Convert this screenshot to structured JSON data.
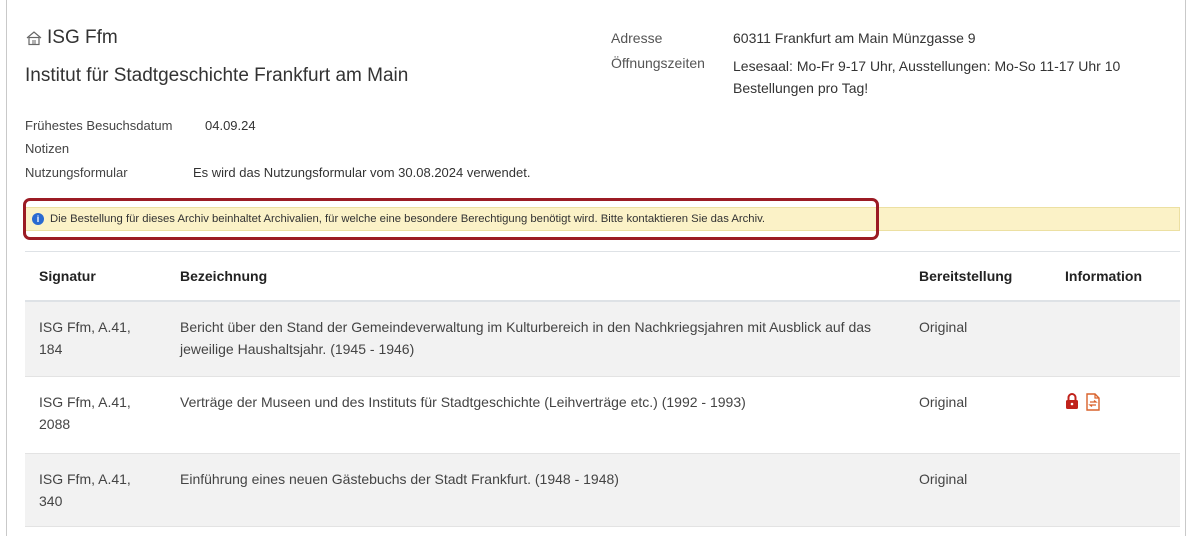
{
  "header": {
    "title": "ISG Ffm",
    "subtitle": "Institut für Stadtgeschichte Frankfurt am Main",
    "address_label": "Adresse",
    "address_value": "60311 Frankfurt am Main Münzgasse 9",
    "hours_label": "Öffnungszeiten",
    "hours_value": "Lesesaal: Mo-Fr 9-17 Uhr, Ausstellungen: Mo-So 11-17 Uhr 10 Bestellungen pro Tag!"
  },
  "meta": {
    "visit_label": "Frühestes Besuchsdatum",
    "visit_value": "04.09.24",
    "notes_label": "Notizen",
    "form_label": "Nutzungsformular",
    "form_value": "Es wird das Nutzungsformular vom 30.08.2024 verwendet."
  },
  "alert": {
    "text": "Die Bestellung für dieses Archiv beinhaltet Archivalien, für welche eine besondere Berechtigung benötigt wird. Bitte kontaktieren Sie das Archiv.",
    "icon": "info-icon",
    "highlight_color": "#9b1b24"
  },
  "table": {
    "headers": [
      "Signatur",
      "Bezeichnung",
      "Bereitstellung",
      "Information"
    ],
    "rows": [
      {
        "signatur": "ISG Ffm, A.41, 184",
        "bezeichnung": "Bericht über den Stand der Gemeindeverwaltung im Kulturbereich in den Nachkriegsjahren mit Ausblick auf das jeweilige Haushaltsjahr. (1945 - 1946)",
        "bereitstellung": "Original"
      },
      {
        "signatur": "ISG Ffm, A.41, 2088",
        "bezeichnung": "Verträge der Museen und des Instituts für Stadtgeschichte (Leihverträge etc.) (1992 - 1993)",
        "bereitstellung": "Original",
        "info_icons": [
          "lock-icon",
          "document-swap-icon"
        ]
      },
      {
        "signatur": "ISG Ffm, A.41, 340",
        "bezeichnung": "Einführung eines neuen Gästebuchs der Stadt Frankfurt. (1948 - 1948)",
        "bereitstellung": "Original"
      }
    ]
  },
  "colors": {
    "alert_bg": "#fbf2c7",
    "icon_red": "#c0221b",
    "icon_orange": "#d9622b",
    "info_blue": "#2a6ad1"
  }
}
